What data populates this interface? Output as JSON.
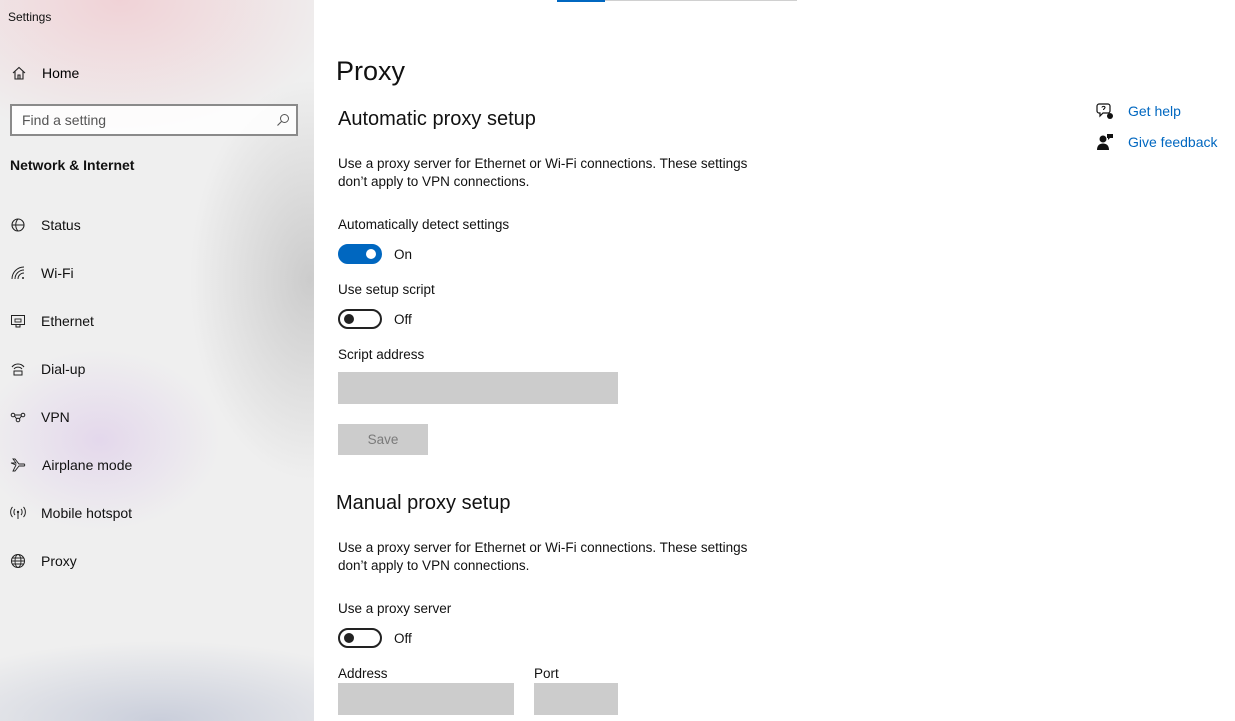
{
  "app": {
    "title": "Settings"
  },
  "sidebar": {
    "home_label": "Home",
    "search_placeholder": "Find a setting",
    "section_title": "Network & Internet",
    "items": [
      {
        "label": "Status",
        "icon": "status-icon"
      },
      {
        "label": "Wi-Fi",
        "icon": "wifi-icon"
      },
      {
        "label": "Ethernet",
        "icon": "ethernet-icon"
      },
      {
        "label": "Dial-up",
        "icon": "dialup-icon"
      },
      {
        "label": "VPN",
        "icon": "vpn-icon"
      },
      {
        "label": "Airplane mode",
        "icon": "airplane-icon"
      },
      {
        "label": "Mobile hotspot",
        "icon": "hotspot-icon"
      },
      {
        "label": "Proxy",
        "icon": "globe-icon"
      }
    ]
  },
  "main": {
    "title": "Proxy",
    "automatic": {
      "heading": "Automatic proxy setup",
      "description": "Use a proxy server for Ethernet or Wi-Fi connections. These settings don’t apply to VPN connections.",
      "detect_label": "Automatically detect settings",
      "detect_state": "On",
      "script_label": "Use setup script",
      "script_state": "Off",
      "script_address_label": "Script address",
      "script_address_value": "",
      "save_label": "Save"
    },
    "manual": {
      "heading": "Manual proxy setup",
      "description": "Use a proxy server for Ethernet or Wi-Fi connections. These settings don’t apply to VPN connections.",
      "use_proxy_label": "Use a proxy server",
      "use_proxy_state": "Off",
      "address_label": "Address",
      "address_value": "",
      "port_label": "Port",
      "port_value": ""
    }
  },
  "help": {
    "get_help": "Get help",
    "give_feedback": "Give feedback"
  },
  "colors": {
    "accent": "#0067c0",
    "disabled_field": "#cccccc"
  }
}
